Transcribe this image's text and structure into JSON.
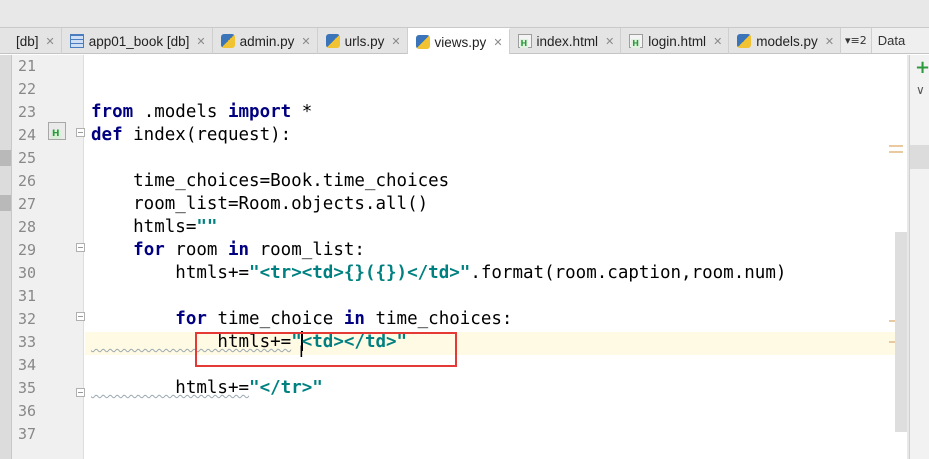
{
  "tabs": [
    {
      "label": "[db]",
      "icon": "none",
      "active": false
    },
    {
      "label": "app01_book [db]",
      "icon": "table-icon",
      "active": false
    },
    {
      "label": "admin.py",
      "icon": "python-file-icon",
      "active": false
    },
    {
      "label": "urls.py",
      "icon": "python-file-icon",
      "active": false
    },
    {
      "label": "views.py",
      "icon": "python-file-icon",
      "active": true
    },
    {
      "label": "index.html",
      "icon": "html-file-icon",
      "active": false
    },
    {
      "label": "login.html",
      "icon": "html-file-icon",
      "active": false
    },
    {
      "label": "models.py",
      "icon": "python-file-icon",
      "active": false
    }
  ],
  "tabs_overflow": "▾≡2",
  "right_stub_label": "Data",
  "line_numbers": [
    "21",
    "22",
    "23",
    "24",
    "25",
    "26",
    "27",
    "28",
    "29",
    "30",
    "31",
    "32",
    "33",
    "34",
    "35",
    "36",
    "37"
  ],
  "code": {
    "l23": {
      "kw1": "from",
      "t1": " .models ",
      "kw2": "import",
      "t2": " *"
    },
    "l24": {
      "kw1": "def",
      "t1": " index(request):"
    },
    "l26": {
      "t1": "    time_choices=Book.time_choices"
    },
    "l27": {
      "t1": "    room_list=Room.objects.all()"
    },
    "l28": {
      "t1": "    htmls=",
      "s1": "\"\""
    },
    "l29": {
      "t0": "    ",
      "kw1": "for",
      "t1": " room ",
      "kw2": "in",
      "t2": " room_list:"
    },
    "l30": {
      "t1": "        htmls+=",
      "s1": "\"<tr><td>{}({})</td>\"",
      "t2": ".format(room.caption,room.num)"
    },
    "l32": {
      "t0": "        ",
      "kw1": "for",
      "t1": " time_choice ",
      "kw2": "in",
      "t2": " time_choices:"
    },
    "l33": {
      "t1": "            htmls+=",
      "s1a": "\"",
      "s1b": "<td></td>\""
    },
    "l35": {
      "t1": "        htmls+=",
      "s1": "\"</tr>\""
    }
  },
  "side_panel": {
    "add": "+",
    "chevron": "∨"
  },
  "colors": {
    "keyword": "#000080",
    "string": "#008080",
    "highlight_box": "#e53935",
    "current_line": "#fffae3"
  }
}
